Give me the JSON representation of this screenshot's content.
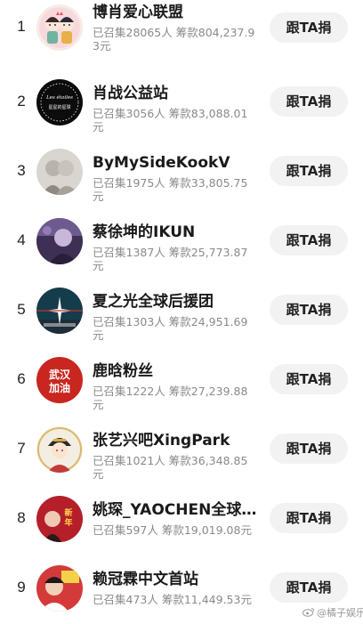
{
  "stats_label_recruited": "已召集",
  "stats_unit_people": "人",
  "stats_label_raised": "筹款",
  "stats_unit_currency": "元",
  "button_label": "跟TA捐",
  "watermark": "@橘子娱乐",
  "rows": [
    {
      "rank": "1",
      "name": "博肖爱心联盟",
      "stats": "已召集28065人 筹款804,237.93元",
      "avatar": "cartoon-couple"
    },
    {
      "rank": "2",
      "name": "肖战公益站",
      "stats": "已召集3056人 筹款83,088.01元",
      "avatar": "les-etoiles-badge"
    },
    {
      "rank": "3",
      "name": "ByMySideKookV",
      "stats": "已召集1975人 筹款33,805.75元",
      "avatar": "photo-grey"
    },
    {
      "rank": "4",
      "name": "蔡徐坤的IKUN",
      "stats": "已召集1387人 筹款25,773.87元",
      "avatar": "photo-purple"
    },
    {
      "rank": "5",
      "name": "夏之光全球后援团",
      "stats": "已召集1303人 筹款24,951.69元",
      "avatar": "star-logo"
    },
    {
      "rank": "6",
      "name": "鹿晗粉丝",
      "stats": "已召集1222人 筹款27,239.88元",
      "avatar": "wuhan-jiayou",
      "avatar_text": [
        "武汉",
        "加油"
      ]
    },
    {
      "rank": "7",
      "name": "张艺兴吧XingPark",
      "stats": "已召集1021人 筹款36,348.85元",
      "avatar": "cartoon-portrait"
    },
    {
      "rank": "8",
      "name": "姚琛_YAOCHEN全球…",
      "stats": "已召集597人 筹款19,019.08元",
      "avatar": "new-year-red",
      "avatar_text": [
        "新",
        "年"
      ]
    },
    {
      "rank": "9",
      "name": "赖冠霖中文首站",
      "stats": "已召集473人 筹款11,449.53元",
      "avatar": "photo-red"
    }
  ],
  "colors": {
    "button_bg": "#f2f2f2",
    "name_text": "#1a1a1a",
    "stats_text": "#8a8a8a"
  }
}
